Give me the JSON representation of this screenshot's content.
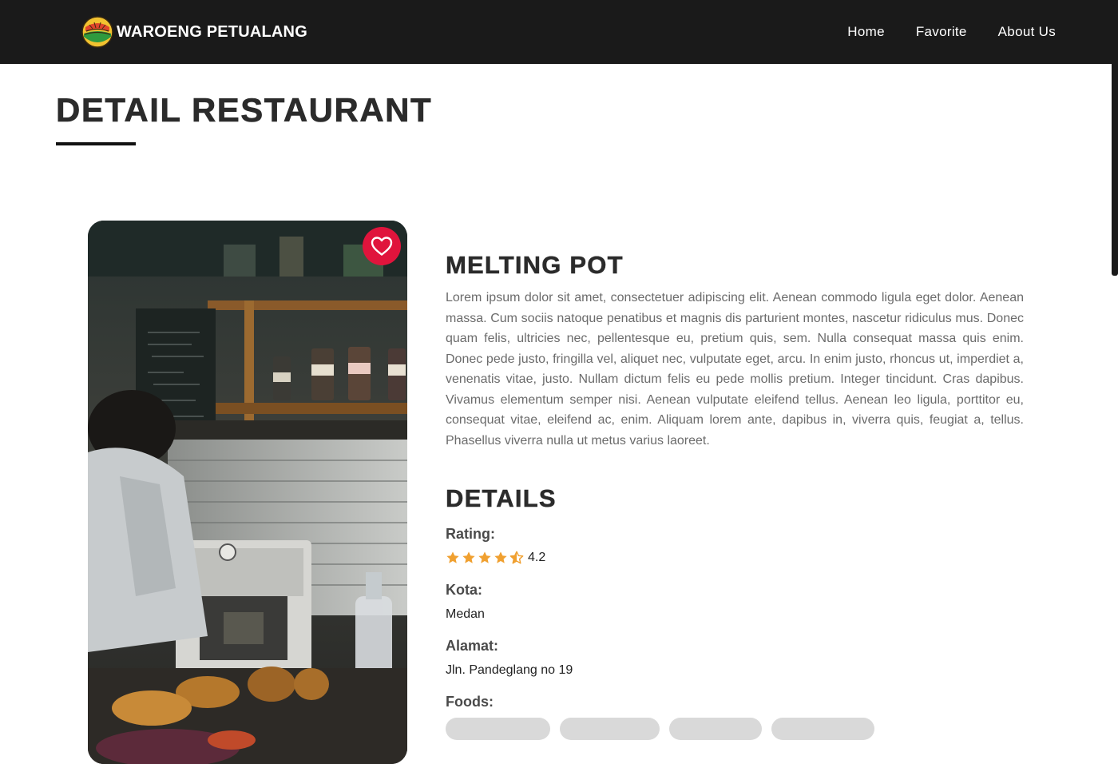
{
  "navbar": {
    "brand": "WAROENG PETUALANG",
    "links": [
      "Home",
      "Favorite",
      "About Us"
    ]
  },
  "page": {
    "title": "DETAIL RESTAURANT"
  },
  "restaurant": {
    "name": "MELTING POT",
    "description": "Lorem ipsum dolor sit amet, consectetuer adipiscing elit. Aenean commodo ligula eget dolor. Aenean massa. Cum sociis natoque penatibus et magnis dis parturient montes, nascetur ridiculus mus. Donec quam felis, ultricies nec, pellentesque eu, pretium quis, sem. Nulla consequat massa quis enim. Donec pede justo, fringilla vel, aliquet nec, vulputate eget, arcu. In enim justo, rhoncus ut, imperdiet a, venenatis vitae, justo. Nullam dictum felis eu pede mollis pretium. Integer tincidunt. Cras dapibus. Vivamus elementum semper nisi. Aenean vulputate eleifend tellus. Aenean leo ligula, porttitor eu, consequat vitae, eleifend ac, enim. Aliquam lorem ante, dapibus in, viverra quis, feugiat a, tellus. Phasellus viverra nulla ut metus varius laoreet.",
    "favorite_icon": "heart-outline-icon",
    "photo_icon": "restaurant-photo"
  },
  "details": {
    "heading": "DETAILS",
    "rating_label": "Rating:",
    "rating_value": "4.2",
    "rating": 4.2,
    "rating_max": 5,
    "city_label": "Kota:",
    "city": "Medan",
    "address_label": "Alamat:",
    "address": "Jln. Pandeglang no 19",
    "foods_label": "Foods:"
  },
  "colors": {
    "navbar_bg": "#1a1a1a",
    "favorite_button": "#e0143c",
    "star": "#f0a030",
    "chip_bg": "#d9d9d9"
  }
}
